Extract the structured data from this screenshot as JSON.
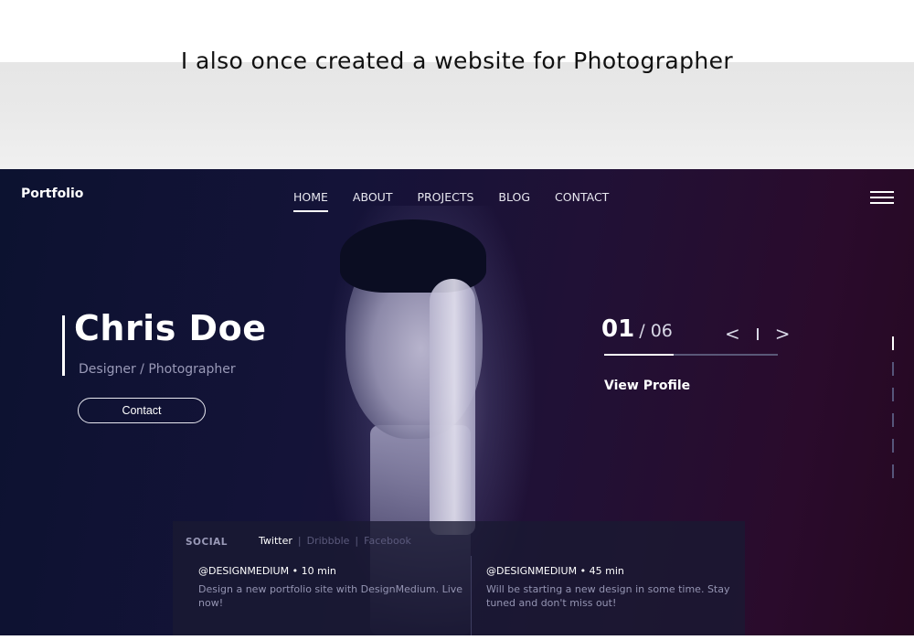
{
  "caption": "I also once created a website for Photographer",
  "header": {
    "brand": "Portfolio",
    "nav": [
      "HOME",
      "ABOUT",
      "PROJECTS",
      "BLOG",
      "CONTACT"
    ],
    "active_nav": "HOME",
    "menu_icon": "hamburger-menu-icon"
  },
  "hero": {
    "name": "Chris Doe",
    "role": "Designer / Photographer",
    "contact_label": "Contact"
  },
  "slider": {
    "current": "01",
    "total": "/ 06",
    "prev_icon": "<",
    "next_icon": ">",
    "progress_fraction": 0.4,
    "view_profile": "View Profile"
  },
  "scroll_indicator": {
    "count": 6,
    "active_index": 0
  },
  "social": {
    "label": "SOCIAL",
    "tabs": [
      "Twitter",
      "Dribbble",
      "Facebook"
    ],
    "active_tab": "Twitter",
    "posts": [
      {
        "handle": "@DESIGNMEDIUM",
        "time": "10 min",
        "text": "Design a new portfolio site with DesignMedium. Live now!"
      },
      {
        "handle": "@DESIGNMEDIUM",
        "time": "45 min",
        "text": "Will be starting a new design in some time. Stay tuned and don't miss out!"
      }
    ]
  },
  "colors": {
    "bg_left": "#0c1230",
    "bg_right": "#250821",
    "accent": "#ffffff"
  }
}
